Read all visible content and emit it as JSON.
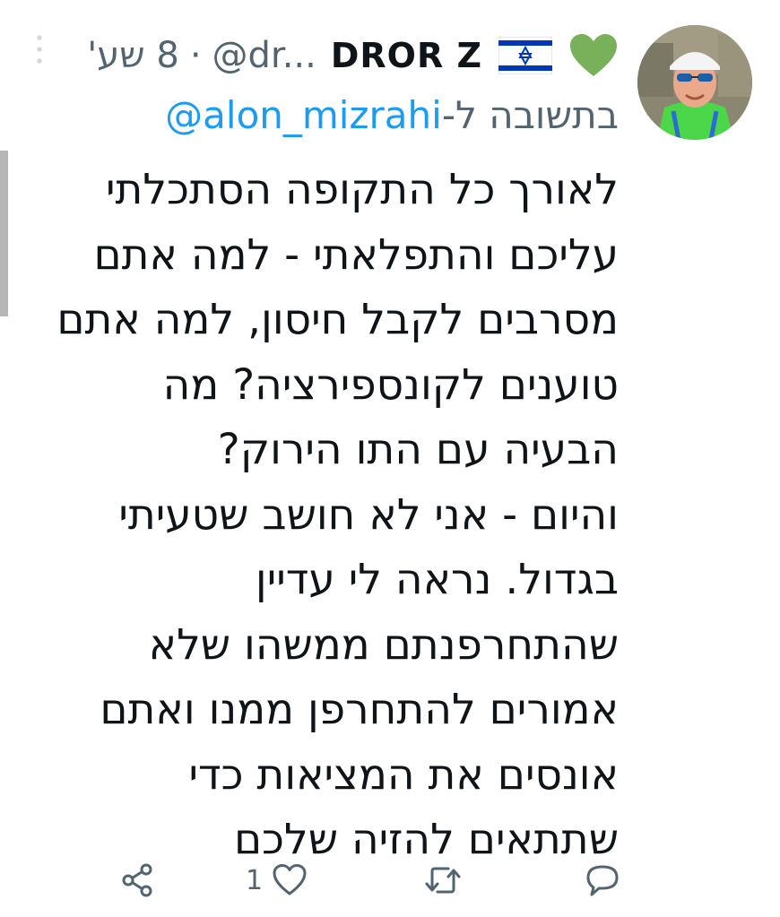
{
  "tweet": {
    "author_name": "DROR Z",
    "author_handle": "@dr...",
    "separator": "·",
    "time": "8 שע'",
    "reply_prefix": "בתשובה ל-",
    "reply_mention": "@alon_mizrahi",
    "body_lines": [
      "לאורך כל התקופה הסתכלתי",
      "עליכם והתפלאתי - למה אתם",
      "מסרבים לקבל חיסון, למה אתם",
      "טוענים לקונספירציה? מה",
      "הבעיה עם התו הירוק?",
      " והיום - אני לא חושב שטעיתי",
      "בגדול. נראה לי עדיין",
      "שהתחרפנתם ממשהו שלא",
      "אמורים להתחרפן ממנו ואתם",
      "אונסים את המציאות כדי",
      "שתתאים להזיה שלכם"
    ],
    "like_count": "1"
  },
  "icons": {
    "heart_emoji": "green-heart-emoji",
    "flag": "israel-flag-emoji",
    "more": "more-vertical-icon",
    "reply": "reply-icon",
    "retweet": "retweet-icon",
    "like": "like-icon",
    "share": "share-icon"
  },
  "colors": {
    "text": "#0f1419",
    "secondary": "#536471",
    "link": "#1d9bf0",
    "heart_emoji": "#78b159",
    "flag_blue": "#0038b8"
  }
}
